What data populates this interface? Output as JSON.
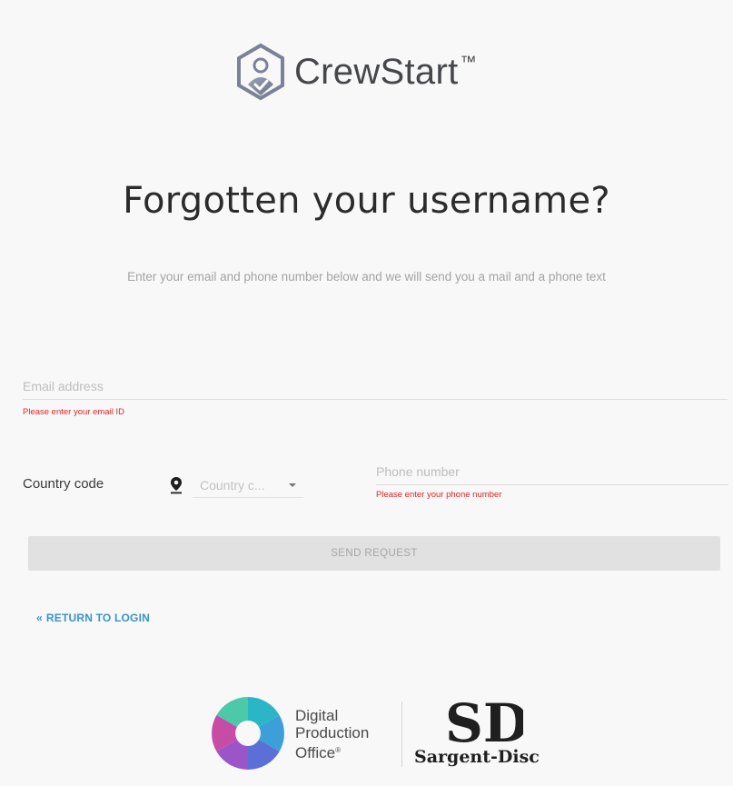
{
  "brand": {
    "name": "CrewStart",
    "trademark": "™"
  },
  "heading": {
    "title": "Forgotten your username?",
    "subtitle": "Enter your email and phone number below and we will send you a mail and a phone text"
  },
  "form": {
    "email": {
      "placeholder": "Email address",
      "value": "",
      "error": "Please enter your email ID"
    },
    "country_code": {
      "label": "Country code",
      "placeholder": "Country c...",
      "icon": "map-pin-icon"
    },
    "phone": {
      "placeholder": "Phone number",
      "value": "",
      "error": "Please enter your phone number"
    },
    "send_button": "SEND REQUEST"
  },
  "return_link": {
    "arrow": "«",
    "label": "RETURN TO LOGIN"
  },
  "footer": {
    "dpo": {
      "line1": "Digital",
      "line2": "Production",
      "line3": "Office",
      "reg": "®"
    },
    "sd": {
      "monogram": "SD",
      "name": "Sargent-Disc"
    }
  },
  "colors": {
    "error": "#e02424",
    "link": "#3a93c9",
    "button_bg": "#e1e1e1",
    "button_text": "#a6a6a6"
  }
}
